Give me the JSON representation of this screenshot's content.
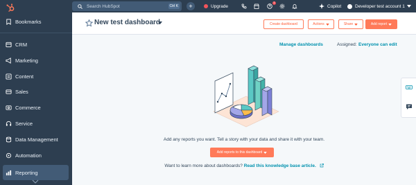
{
  "sidebar": {
    "items": [
      {
        "label": "Bookmarks",
        "icon": "bookmark-icon"
      },
      {
        "label": "CRM",
        "icon": "crm-icon"
      },
      {
        "label": "Marketing",
        "icon": "marketing-icon"
      },
      {
        "label": "Content",
        "icon": "content-icon"
      },
      {
        "label": "Sales",
        "icon": "sales-icon"
      },
      {
        "label": "Commerce",
        "icon": "commerce-icon"
      },
      {
        "label": "Service",
        "icon": "service-icon"
      },
      {
        "label": "Data Management",
        "icon": "data-icon"
      },
      {
        "label": "Automation",
        "icon": "automation-icon"
      },
      {
        "label": "Reporting",
        "icon": "reporting-icon",
        "active": true
      }
    ]
  },
  "topbar": {
    "search_placeholder": "Search HubSpot",
    "shortcut": "Ctrl K",
    "upgrade_label": "Upgrade",
    "notification_count": "1",
    "copilot_label": "Copilot",
    "account_label": "Developer test account 1"
  },
  "header": {
    "title": "New test dashboard",
    "create_dashboard": "Create dashboard",
    "actions": "Actions",
    "share": "Share",
    "add_report": "Add report"
  },
  "main": {
    "manage_dashboards": "Manage dashboards",
    "assigned_label": "Assigned:",
    "assigned_value": "Everyone can edit",
    "tagline": "Add any reports you want. Tell a story with your data and share it with your team.",
    "add_reports_button": "Add reports to this dashboard",
    "learn_prefix": "Want to learn more about dashboards?",
    "learn_link": "Read this knowledge base article."
  },
  "colors": {
    "sidebar_bg": "#2d3e50",
    "accent_orange": "#ff7a59",
    "link_teal": "#0091ae"
  }
}
